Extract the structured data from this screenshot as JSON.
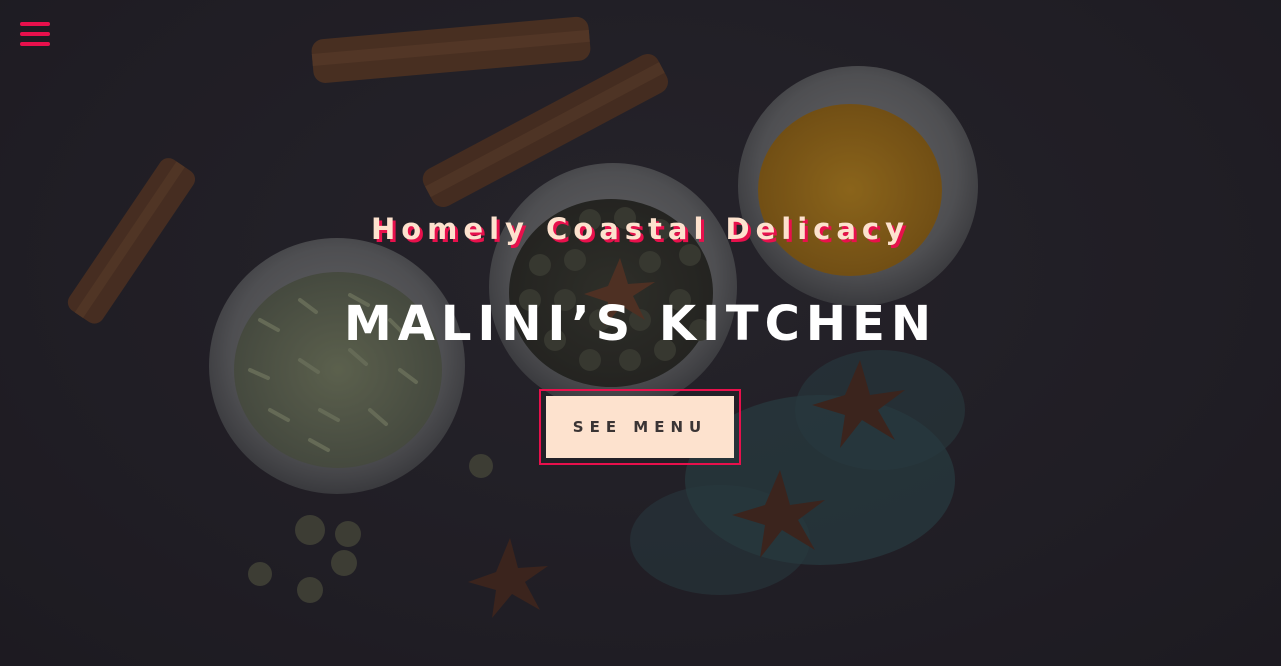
{
  "colors": {
    "accent": "#e8104c",
    "button_bg": "#fde2ce",
    "tagline_text": "#fde2ce",
    "title_text": "#ffffff",
    "background": "#242228"
  },
  "nav": {
    "menu_icon": "hamburger-menu-icon"
  },
  "hero": {
    "tagline": "Homely Coastal Delicacy",
    "title": "MALINI’S KITCHEN",
    "cta_label": "SEE MENU"
  }
}
